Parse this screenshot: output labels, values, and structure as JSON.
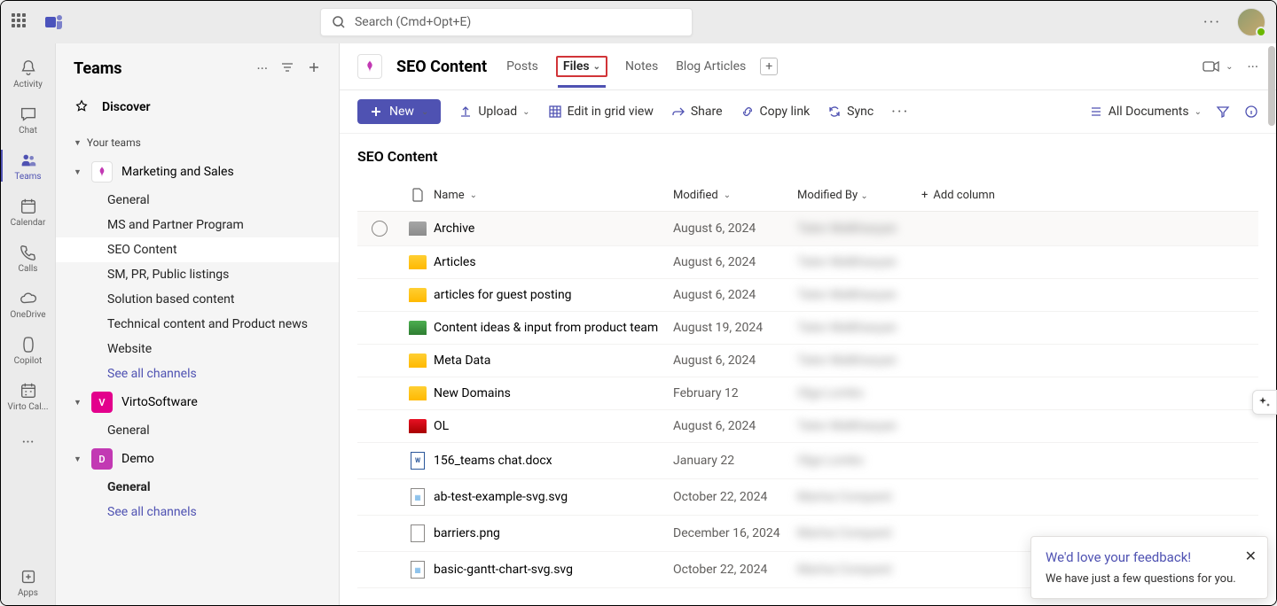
{
  "search": {
    "placeholder": "Search (Cmd+Opt+E)"
  },
  "rail": {
    "items": [
      {
        "label": "Activity",
        "icon": "bell"
      },
      {
        "label": "Chat",
        "icon": "chat"
      },
      {
        "label": "Teams",
        "icon": "teams",
        "active": true
      },
      {
        "label": "Calendar",
        "icon": "calendar"
      },
      {
        "label": "Calls",
        "icon": "calls"
      },
      {
        "label": "OneDrive",
        "icon": "onedrive"
      },
      {
        "label": "Copilot",
        "icon": "copilot"
      },
      {
        "label": "Virto Cal...",
        "icon": "virto"
      }
    ],
    "apps_label": "Apps"
  },
  "teams_panel": {
    "title": "Teams",
    "discover": "Discover",
    "your_teams_label": "Your teams",
    "teams": [
      {
        "name": "Marketing and Sales",
        "avatar": "white-logo",
        "channels": [
          {
            "name": "General"
          },
          {
            "name": "MS and Partner Program"
          },
          {
            "name": "SEO Content",
            "selected": true
          },
          {
            "name": "SM, PR, Public listings"
          },
          {
            "name": "Solution based content"
          },
          {
            "name": "Technical content and Product news"
          },
          {
            "name": "Website"
          }
        ],
        "see_all": "See all channels"
      },
      {
        "name": "VirtoSoftware",
        "avatar": "pink-v",
        "avatar_letter": "V",
        "channels": [
          {
            "name": "General"
          }
        ]
      },
      {
        "name": "Demo",
        "avatar": "pink-d",
        "avatar_letter": "D",
        "channels": [
          {
            "name": "General",
            "bold": true
          }
        ],
        "see_all": "See all channels"
      }
    ]
  },
  "channel_header": {
    "title": "SEO Content",
    "tabs": [
      {
        "label": "Posts"
      },
      {
        "label": "Files",
        "active": true
      },
      {
        "label": "Notes"
      },
      {
        "label": "Blog Articles"
      }
    ]
  },
  "toolbar": {
    "new": "New",
    "upload": "Upload",
    "edit_grid": "Edit in grid view",
    "share": "Share",
    "copy_link": "Copy link",
    "sync": "Sync",
    "all_documents": "All Documents"
  },
  "library": {
    "title": "SEO Content",
    "columns": {
      "name": "Name",
      "modified": "Modified",
      "modified_by": "Modified By",
      "add": "Add column"
    },
    "rows": [
      {
        "type": "folder",
        "color": "gray",
        "name": "Archive",
        "modified": "August 6, 2024",
        "by": "Tatev Malkhasyan",
        "hovered": true
      },
      {
        "type": "folder",
        "color": "yellow",
        "name": "Articles",
        "modified": "August 6, 2024",
        "by": "Tatev Malkhasyan"
      },
      {
        "type": "folder",
        "color": "yellow",
        "name": "articles for guest posting",
        "modified": "August 6, 2024",
        "by": "Tatev Malkhasyan"
      },
      {
        "type": "folder",
        "color": "green",
        "name": "Content ideas & input from product team",
        "modified": "August 19, 2024",
        "by": "Tatev Malkhasyan"
      },
      {
        "type": "folder",
        "color": "yellow",
        "name": "Meta Data",
        "modified": "August 6, 2024",
        "by": "Tatev Malkhasyan"
      },
      {
        "type": "folder",
        "color": "yellow",
        "name": "New Domains",
        "modified": "February 12",
        "by": "Olga Lomko"
      },
      {
        "type": "folder",
        "color": "red",
        "name": "OL",
        "modified": "August 6, 2024",
        "by": "Tatev Malkhasyan"
      },
      {
        "type": "docx",
        "name": "156_teams chat.docx",
        "modified": "January 22",
        "by": "Olga Lomko"
      },
      {
        "type": "svg",
        "name": "ab-test-example-svg.svg",
        "modified": "October 22, 2024",
        "by": "Marina Conquest"
      },
      {
        "type": "png",
        "name": "barriers.png",
        "modified": "December 16, 2024",
        "by": "Marina Conquest"
      },
      {
        "type": "svg",
        "name": "basic-gantt-chart-svg.svg",
        "modified": "October 22, 2024",
        "by": "Marina Conquest"
      }
    ]
  },
  "feedback": {
    "title": "We'd love your feedback!",
    "body": "We have just a few questions for you."
  }
}
